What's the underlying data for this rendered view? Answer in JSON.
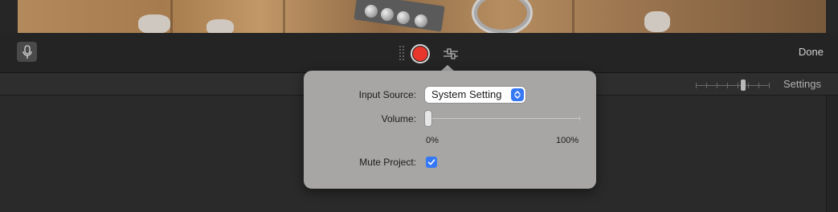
{
  "toolbar": {
    "done_label": "Done"
  },
  "subbar": {
    "settings_label": "Settings"
  },
  "popover": {
    "input_source": {
      "label": "Input Source:",
      "selected": "System Setting"
    },
    "volume": {
      "label": "Volume:",
      "min_label": "0%",
      "max_label": "100%",
      "value": 0
    },
    "mute_project": {
      "label": "Mute Project:",
      "checked": true
    }
  },
  "colors": {
    "record": "#e8362c",
    "accent": "#3478f6",
    "popover_bg": "#a7a6a5"
  },
  "icons": [
    "microphone-icon",
    "record-icon",
    "voiceover-settings-icon",
    "chevron-updown-icon",
    "checkmark-icon"
  ]
}
